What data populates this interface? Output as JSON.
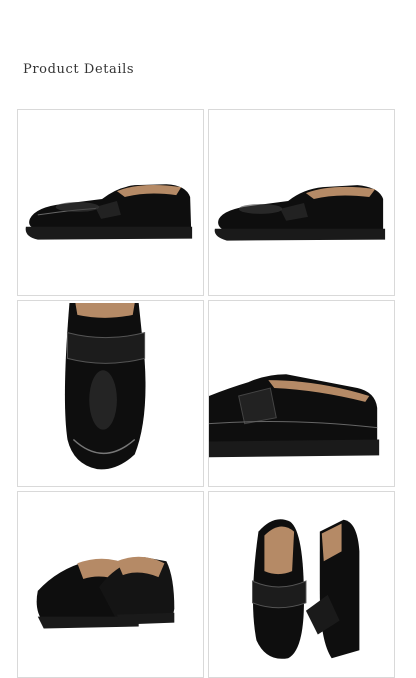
{
  "section": {
    "title": "Product Details"
  },
  "gallery": {
    "images": [
      {
        "name": "loafer-side-view-left"
      },
      {
        "name": "loafer-side-view-right"
      },
      {
        "name": "loafer-top-view"
      },
      {
        "name": "loafer-closeup-side"
      },
      {
        "name": "loafer-pair-rear"
      },
      {
        "name": "loafer-pair-front"
      }
    ]
  },
  "colors": {
    "leather": "#0e0e0e",
    "lining": "#b58a66",
    "sole": "#1a1a1a",
    "border": "#d9d9d9"
  }
}
